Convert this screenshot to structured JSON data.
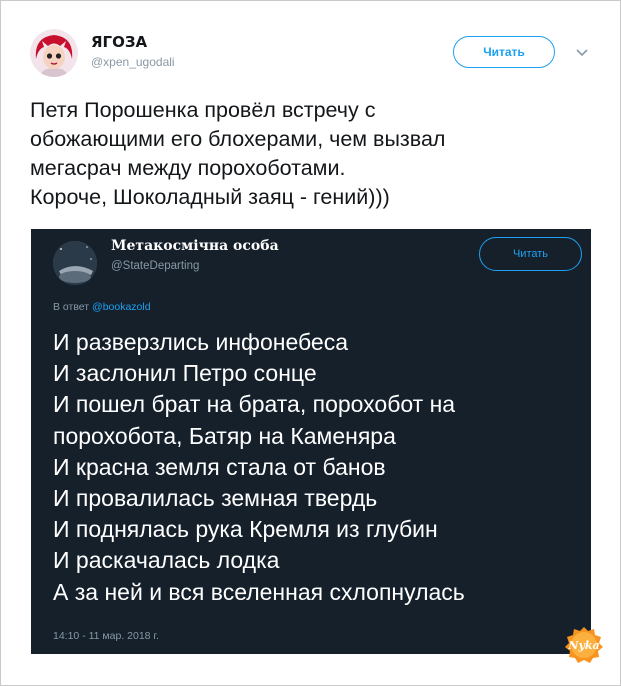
{
  "tweet": {
    "name": "ЯГОЗА",
    "handle": "@xpen_ugodali",
    "follow_label": "Читать",
    "text": "Петя Порошенка провёл встречу с\nобожающими его блохерами, чем вызвал\nмегасрач между порохоботами.\nКороче, Шоколадный заяц - гений)))"
  },
  "embedded_tweet": {
    "name": "Метакосмічна особа",
    "handle": "@StateDeparting",
    "follow_label": "Читать",
    "reply_prefix": "В ответ",
    "reply_to": "@bookazold",
    "text": "И разверзлись инфонебеса\nИ заслонил Петро сонце\nИ пошел брат на брата, порохобот на\nпорохобота, Батяр на Каменяра\nИ красна земля стала от банов\nИ провалилась земная твердь\nИ поднялась рука Кремля из глубин\nИ раскачалась лодка\nА за ней и вся вселенная схлопнулась",
    "timestamp": "14:10 - 11 мар. 2018 г."
  },
  "watermark": {
    "text": "Nyka"
  },
  "colors": {
    "accent": "#1da1f2",
    "dark_bg": "#15202b",
    "muted": "#8899a6",
    "badge": "#f7931e"
  }
}
